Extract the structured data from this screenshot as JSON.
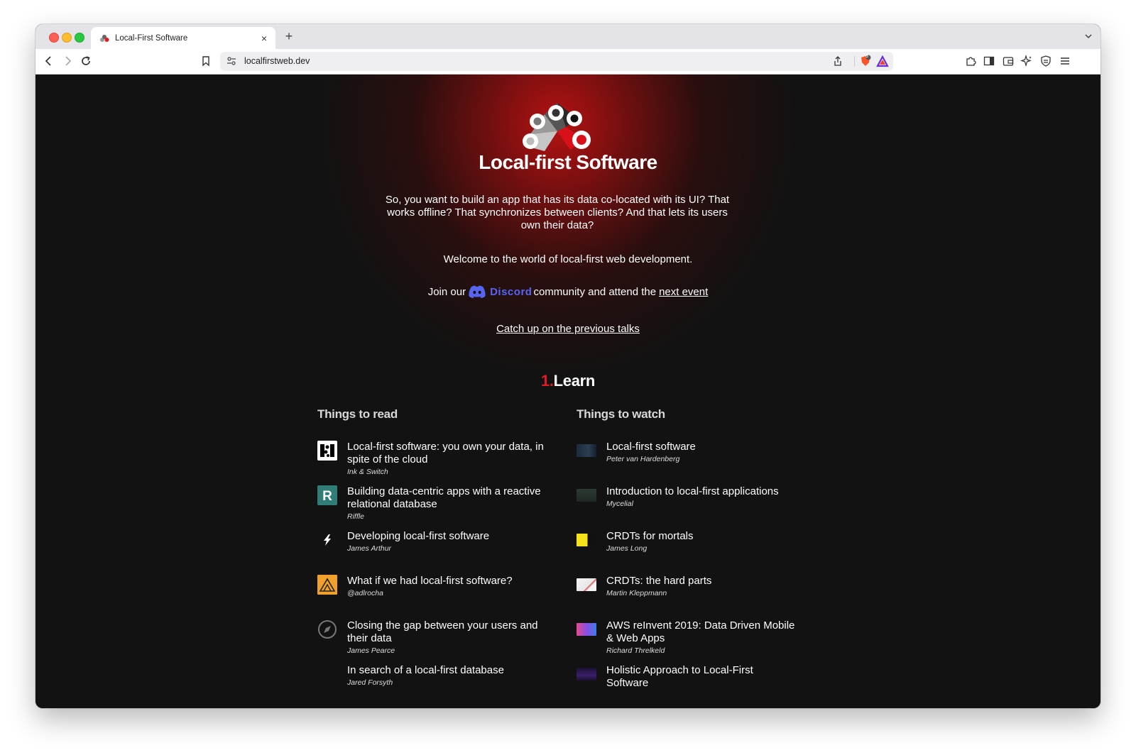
{
  "browser": {
    "tab_title": "Local-First Software",
    "new_tab_symbol": "+",
    "close_symbol": "×",
    "url": "localfirstweb.dev",
    "shield_badge": "3"
  },
  "hero": {
    "site_title": "Local-first Software",
    "intro": "So, you want to build an app that has its data co-located with its UI? That works offline? That synchronizes between clients? And that lets its users own their data?",
    "welcome": "Welcome to the world of local-first web development.",
    "join_prefix": "Join our",
    "discord_label": "Discord",
    "join_middle": "community and attend the",
    "next_event_link": "next event",
    "talks_link": "Catch up on the previous talks"
  },
  "section": {
    "number": "1.",
    "title": "Learn"
  },
  "read": {
    "heading": "Things to read",
    "items": [
      {
        "title": "Local-first software: you own your data, in spite of the cloud",
        "source": "Ink & Switch",
        "icon": "ink-and-switch-icon"
      },
      {
        "title": "Building data-centric apps with a reactive relational database",
        "source": "Riffle",
        "icon": "riffle-icon"
      },
      {
        "title": "Developing local-first software",
        "source": "James Arthur",
        "icon": "electric-icon"
      },
      {
        "title": "What if we had local-first software?",
        "source": "@adlrocha",
        "icon": "substack-icon"
      },
      {
        "title": "Closing the gap between your users and their data",
        "source": "James Pearce",
        "icon": "compass-icon"
      },
      {
        "title": "In search of a local-first database",
        "source": "Jared Forsyth",
        "icon": ""
      }
    ]
  },
  "watch": {
    "heading": "Things to watch",
    "items": [
      {
        "title": "Local-first software",
        "source": "Peter van Hardenberg"
      },
      {
        "title": "Introduction to local-first applications",
        "source": "Mycelial"
      },
      {
        "title": "CRDTs for mortals",
        "source": "James Long"
      },
      {
        "title": "CRDTs: the hard parts",
        "source": "Martin Kleppmann"
      },
      {
        "title": "AWS reInvent 2019: Data Driven Mobile & Web Apps",
        "source": "Richard Threlkeld"
      },
      {
        "title": "Holistic Approach to Local-First Software",
        "source": ""
      }
    ]
  },
  "colors": {
    "accent_red": "#e01b24",
    "discord_blue": "#5865f2",
    "page_bg": "#121212"
  }
}
